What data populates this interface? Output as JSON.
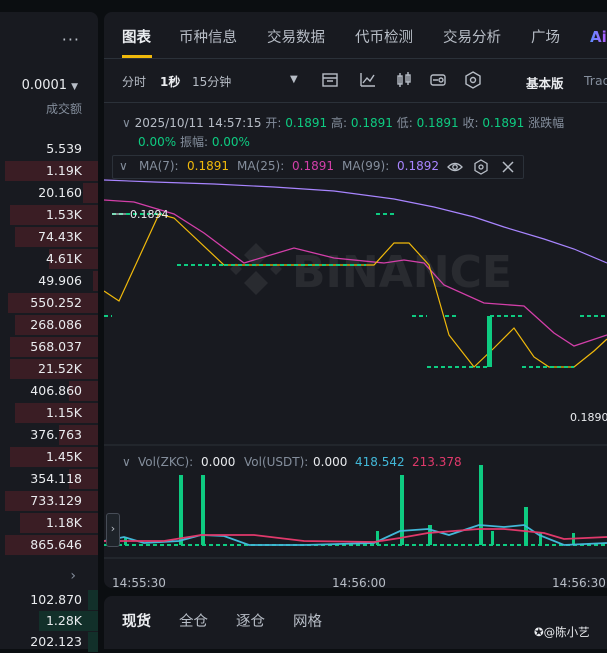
{
  "orderbook": {
    "more_label": "···",
    "precision": "0.0001",
    "header": "成交额",
    "more_icon": "chevron-right-icon",
    "colors": {
      "sell_bg": "#3a1d24",
      "buy_bg": "#12302a"
    },
    "rows": [
      {
        "amount": "5.539",
        "side": "sell",
        "depth": 0.0
      },
      {
        "amount": "1.19K",
        "side": "sell",
        "depth": 0.95
      },
      {
        "amount": "20.160",
        "side": "sell",
        "depth": 0.15
      },
      {
        "amount": "1.53K",
        "side": "sell",
        "depth": 0.9
      },
      {
        "amount": "74.43K",
        "side": "sell",
        "depth": 0.85
      },
      {
        "amount": "4.61K",
        "side": "sell",
        "depth": 0.5
      },
      {
        "amount": "49.906",
        "side": "sell",
        "depth": 0.05
      },
      {
        "amount": "550.252",
        "side": "sell",
        "depth": 0.92
      },
      {
        "amount": "268.086",
        "side": "sell",
        "depth": 0.85
      },
      {
        "amount": "568.037",
        "side": "sell",
        "depth": 0.9
      },
      {
        "amount": "21.52K",
        "side": "sell",
        "depth": 0.9
      },
      {
        "amount": "406.860",
        "side": "sell",
        "depth": 0.3
      },
      {
        "amount": "1.15K",
        "side": "sell",
        "depth": 0.85
      },
      {
        "amount": "376.763",
        "side": "sell",
        "depth": 0.4
      },
      {
        "amount": "1.45K",
        "side": "sell",
        "depth": 0.9
      },
      {
        "amount": "354.118",
        "side": "sell",
        "depth": 0.3
      },
      {
        "amount": "733.129",
        "side": "sell",
        "depth": 0.95
      },
      {
        "amount": "1.18K",
        "side": "sell",
        "depth": 0.8
      },
      {
        "amount": "865.646",
        "side": "sell",
        "depth": 0.95
      }
    ],
    "buy_rows": [
      {
        "amount": "102.870",
        "depth": 0.1
      },
      {
        "amount": "1.28K",
        "depth": 0.6
      },
      {
        "amount": "202.123",
        "depth": 0.1
      }
    ]
  },
  "tabs": {
    "items": [
      "图表",
      "币种信息",
      "交易数据",
      "代币检测",
      "交易分析",
      "广场"
    ],
    "ai_label": "Ai"
  },
  "toolbar": {
    "timeframes": [
      "分时",
      "1秒",
      "15分钟"
    ],
    "active_timeframe": "1秒",
    "icons": [
      "indicator-icon",
      "line-chart-icon",
      "candle-icon",
      "settings-icon",
      "hex-icon"
    ],
    "basic_label": "基本版",
    "trading_label": "Trad"
  },
  "ohlc": {
    "datetime": "2025/10/11 14:57:15",
    "open_label": "开:",
    "open": "0.1891",
    "high_label": "高:",
    "high": "0.1891",
    "low_label": "低:",
    "low": "0.1891",
    "close_label": "收:",
    "close": "0.1891",
    "change_label": "涨跌幅",
    "change": "0.00%",
    "amp_label": "振幅:",
    "amp": "0.00%"
  },
  "ma": {
    "ma7_label": "MA(7):",
    "ma7": "0.1891",
    "ma25_label": "MA(25):",
    "ma25": "0.1891",
    "ma99_label": "MA(99):",
    "ma99": "0.1892"
  },
  "chart": {
    "high_marker": "0.1894",
    "low_marker": "0.1890",
    "watermark": "BINANCE",
    "colors": {
      "up": "#0ecb81",
      "ma7": "#f0b90b",
      "ma25": "#d33fa9",
      "ma99": "#a885ff",
      "vol_usdt": "#42b8d8",
      "vol_ma": "#e0396b"
    }
  },
  "volume": {
    "zkc_label": "Vol(ZKC):",
    "zkc": "0.000",
    "usdt_label": "Vol(USDT):",
    "usdt": "0.000",
    "ma1": "418.542",
    "ma2": "213.378"
  },
  "xaxis": [
    "14:55:30",
    "14:56:00",
    "14:56:30"
  ],
  "bottom_tabs": [
    "现货",
    "全仓",
    "逐仓",
    "网格"
  ],
  "watermark_user": "@陈小艺"
}
